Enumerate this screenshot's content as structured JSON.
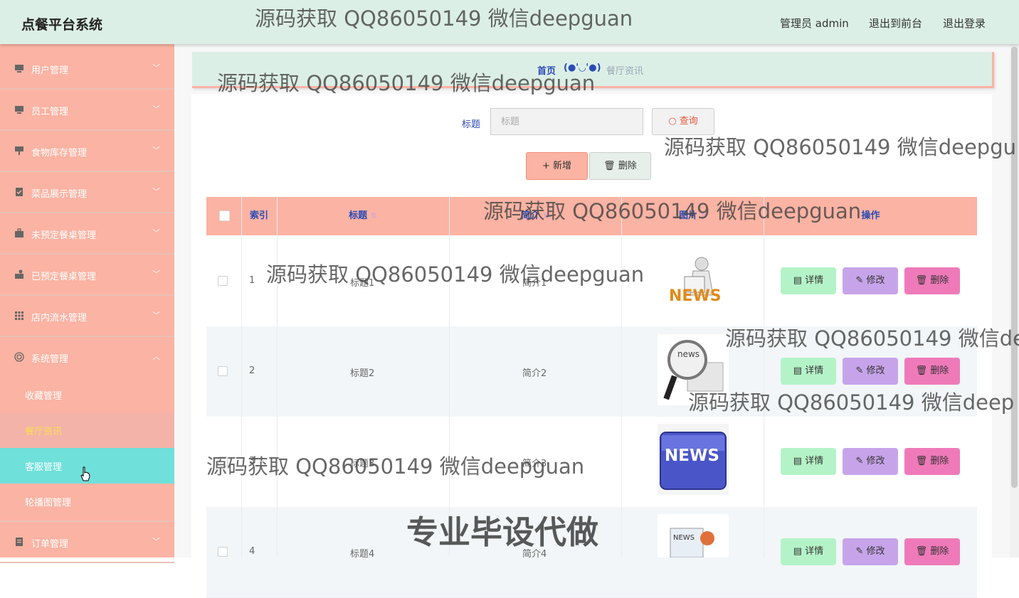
{
  "header": {
    "title": "点餐平台系统",
    "admin": "管理员 admin",
    "to_front": "退出到前台",
    "logout": "退出登录"
  },
  "sidebar": {
    "items": [
      {
        "label": "用户管理",
        "icon": "monitor-icon"
      },
      {
        "label": "员工管理",
        "icon": "monitor-icon"
      },
      {
        "label": "食物库存管理",
        "icon": "screen-stand-icon"
      },
      {
        "label": "菜品展示管理",
        "icon": "clipboard-check-icon"
      },
      {
        "label": "未预定餐桌管理",
        "icon": "briefcase-icon"
      },
      {
        "label": "已预定餐桌管理",
        "icon": "hand-coin-icon"
      },
      {
        "label": "店内流水管理",
        "icon": "grid-icon"
      },
      {
        "label": "系统管理",
        "icon": "settings-circle-icon"
      }
    ],
    "sub_items": [
      "收藏管理",
      "餐厅资讯",
      "客服管理",
      "轮播图管理"
    ],
    "bottom_item": {
      "label": "订单管理",
      "icon": "clipboard-icon"
    }
  },
  "breadcrumb": {
    "home": "首页",
    "separator": "(●'◡'●)",
    "current": "餐厅资讯"
  },
  "search": {
    "label": "标题",
    "placeholder": "标题",
    "button": "查询"
  },
  "actions": {
    "add": "新增",
    "delete": "删除"
  },
  "table": {
    "headers": [
      "索引",
      "标题",
      "简介",
      "图片",
      "操作"
    ],
    "rows": [
      {
        "index": "1",
        "title": "标题1",
        "intro": "简介1"
      },
      {
        "index": "2",
        "title": "标题2",
        "intro": "简介2"
      },
      {
        "index": "3",
        "title": "标题3",
        "intro": "简介3"
      },
      {
        "index": "4",
        "title": "标题4",
        "intro": "简介4"
      }
    ],
    "row_buttons": {
      "detail": "详情",
      "edit": "修改",
      "delete": "删除"
    }
  },
  "watermarks": {
    "text": "源码获取 QQ86050149 微信deepguan",
    "text_cut_a": "源码获取 QQ86050149 微信deepgu",
    "text_cut_b": "源码获取 QQ86050149 微信de",
    "text_cut_c": "源码获取 QQ86050149 微信deep",
    "banner": "专业毕设代做"
  },
  "colors": {
    "header_bg": "#dcefe6",
    "sidebar_bg": "#fbb3a3",
    "active_text": "#f7e14d",
    "hover_bg": "#6fe0da",
    "table_head_bg": "#fbb3a3",
    "detail_btn": "#b4f3c7",
    "edit_btn": "#c7a4ea",
    "delete_btn": "#ef7ab9"
  }
}
